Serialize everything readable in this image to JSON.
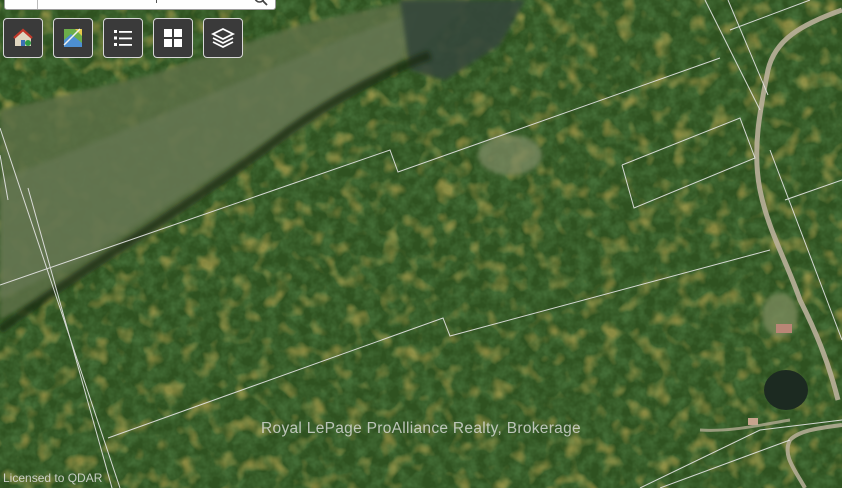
{
  "map": {
    "view": "satellite",
    "content": "aerial-forest-with-parcel-boundaries",
    "colors": {
      "forest_dark": "#1f3a16",
      "forest_mid": "#35561f",
      "meadow": "#556b3e",
      "boundary": "#e6e6e6",
      "road": "#b9b09a"
    }
  },
  "search": {
    "value": "",
    "icon": "search-icon"
  },
  "toolbar": {
    "buttons": [
      {
        "icon": "house-pin-icon"
      },
      {
        "icon": "map-tile-icon"
      },
      {
        "icon": "list-icon"
      },
      {
        "icon": "grid-icon"
      },
      {
        "icon": "layers-icon"
      }
    ]
  },
  "watermark": "Royal LePage ProAlliance Realty, Brokerage",
  "license": "Licensed to QDAR"
}
